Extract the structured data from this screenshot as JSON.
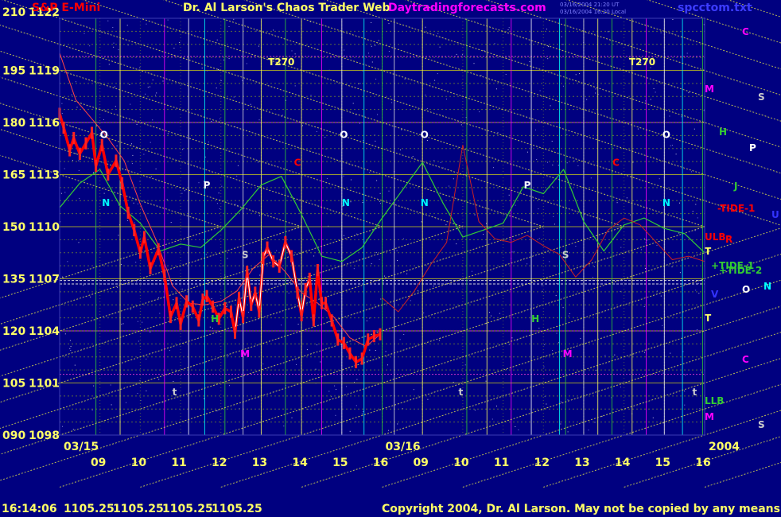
{
  "header": {
    "symbol": "S&P E-Mini",
    "title": "Dr. Al Larson's Chaos Trader Web",
    "site": "Daytradingforecasts.com",
    "stamp1": "03/16/2004 21:20 UT",
    "stamp2": "03/16/2004 16:20 Local",
    "file": "spcctom.txt"
  },
  "footer": {
    "time": "16:14:06",
    "quotes": [
      "1105.25",
      "1105.25",
      "1105.25",
      "1105.25"
    ],
    "copyright": "Copyright 2004, Dr. Al Larson. May not be copied by any means."
  },
  "colors": {
    "background": "#000080",
    "price_red": "#ff0000",
    "price_white": "#ffffff",
    "green_line": "#33cc33",
    "yellow_dot": "#ffff66",
    "magenta": "#ff00ff",
    "cyan": "#00ffff"
  },
  "chart_data": {
    "type": "line",
    "title": "S&P E-Mini",
    "left_axis_labels": [
      "210",
      "195",
      "180",
      "165",
      "150",
      "135",
      "120",
      "105",
      "090"
    ],
    "price_axis_labels": [
      "1122",
      "1119",
      "1116",
      "1113",
      "1110",
      "1107",
      "1104",
      "1101",
      "1098"
    ],
    "ylim": [
      1098,
      1122
    ],
    "date_labels": [
      "03/15",
      "03/16"
    ],
    "hour_labels": [
      "09",
      "10",
      "11",
      "12",
      "13",
      "14",
      "15",
      "16",
      "09",
      "10",
      "11",
      "12",
      "13",
      "14",
      "15",
      "16"
    ],
    "year_label": "2004",
    "xlim": [
      0,
      16
    ],
    "price_series": {
      "name": "price",
      "x": [
        0,
        0.1,
        0.25,
        0.35,
        0.5,
        0.65,
        0.8,
        0.9,
        1.05,
        1.2,
        1.4,
        1.55,
        1.7,
        1.85,
        2.0,
        2.1,
        2.25,
        2.45,
        2.6,
        2.75,
        2.9,
        3.0,
        3.15,
        3.3,
        3.45,
        3.55,
        3.65,
        3.8,
        3.95,
        4.1,
        4.25,
        4.35,
        4.45,
        4.55,
        4.65,
        4.75,
        4.85,
        4.95,
        5.05,
        5.15,
        5.3,
        5.45,
        5.6,
        5.75,
        5.9,
        6.0,
        6.1,
        6.2,
        6.3,
        6.4,
        6.5,
        6.6,
        6.75,
        6.9,
        7.05,
        7.2,
        7.35,
        7.5,
        7.65,
        7.8,
        7.95
      ],
      "values": [
        1116.5,
        1115.7,
        1114.4,
        1115.1,
        1114.2,
        1114.8,
        1115.4,
        1113.5,
        1114.7,
        1113.0,
        1113.8,
        1112.5,
        1110.8,
        1109.8,
        1108.5,
        1109.4,
        1107.6,
        1108.7,
        1107.2,
        1104.8,
        1105.6,
        1104.4,
        1105.7,
        1105.4,
        1104.6,
        1105.8,
        1106.0,
        1105.4,
        1104.7,
        1105.3,
        1105.1,
        1103.9,
        1105.9,
        1104.8,
        1107.4,
        1105.5,
        1106.2,
        1105.1,
        1108.2,
        1108.8,
        1108.0,
        1107.7,
        1109.1,
        1108.3,
        1106.2,
        1104.9,
        1106.4,
        1107.0,
        1104.6,
        1107.5,
        1105.6,
        1105.6,
        1104.6,
        1103.5,
        1103.3,
        1102.7,
        1102.2,
        1102.4,
        1103.5,
        1103.7,
        1103.8
      ]
    },
    "ma_series": {
      "name": "average",
      "x": [
        0,
        0.4,
        0.8,
        1.2,
        1.6,
        2.0,
        2.4,
        2.8,
        3.2,
        3.6,
        4.0,
        4.4,
        4.8,
        5.2,
        5.6,
        6.0,
        6.4,
        6.8,
        7.2,
        7.6,
        7.95
      ],
      "values": [
        1120.0,
        1117.3,
        1116.2,
        1115.1,
        1113.8,
        1111.3,
        1109.2,
        1106.6,
        1105.6,
        1105.5,
        1105.7,
        1106.3,
        1107.6,
        1108.4,
        1107.4,
        1106.2,
        1105.6,
        1104.8,
        1103.6,
        1103.1,
        1103.8
      ]
    },
    "green_series": {
      "name": "oscillator",
      "x": [
        0,
        0.5,
        1.0,
        1.5,
        2.0,
        2.5,
        3.0,
        3.5,
        4.0,
        4.5,
        5.0,
        5.5,
        6.0,
        6.5,
        7.0,
        7.5,
        8.0,
        8.5,
        9.0,
        9.5,
        10.0,
        10.5,
        11.0,
        11.5,
        12.0,
        12.5,
        13.0,
        13.5,
        14.0,
        14.5,
        15.0,
        15.5,
        16.0
      ],
      "values": [
        1111.1,
        1112.5,
        1113.3,
        1111.2,
        1110.2,
        1108.6,
        1109.0,
        1108.8,
        1109.8,
        1111.0,
        1112.4,
        1112.9,
        1110.7,
        1108.3,
        1108.0,
        1108.8,
        1110.5,
        1112.1,
        1113.7,
        1111.4,
        1109.4,
        1109.8,
        1110.2,
        1112.3,
        1111.9,
        1113.3,
        1110.3,
        1108.6,
        1110.1,
        1110.5,
        1109.9,
        1109.6,
        1108.5
      ]
    },
    "red_cycle_series": {
      "name": "cycle",
      "x": [
        8.0,
        8.4,
        8.8,
        9.2,
        9.6,
        10.0,
        10.4,
        10.8,
        11.2,
        11.6,
        12.0,
        12.4,
        12.8,
        13.2,
        13.6,
        14.0,
        14.4,
        14.8,
        15.2,
        15.6,
        16.0
      ],
      "values": [
        1105.9,
        1105.1,
        1106.3,
        1107.8,
        1109.1,
        1114.7,
        1110.3,
        1109.3,
        1109.1,
        1109.5,
        1108.9,
        1108.4,
        1107.1,
        1108.1,
        1109.8,
        1110.5,
        1110.1,
        1109.1,
        1108.1,
        1108.3,
        1108.0
      ]
    },
    "vertical_line_hours": [
      0.9,
      1.5,
      2.6,
      3.2,
      3.6,
      4.1,
      4.55,
      5.0,
      5.6,
      6.0,
      6.5,
      7.0,
      7.55,
      8.0,
      8.3,
      9.0,
      10.1,
      10.6,
      11.2,
      11.7,
      12.4,
      12.55,
      13.0,
      13.35,
      13.7,
      14.2,
      14.55,
      15.0,
      15.45,
      15.95
    ],
    "signal_labels": [
      {
        "text": "T270",
        "x": 5.5,
        "y": 1119.3,
        "color": "#ffff66"
      },
      {
        "text": "T270",
        "x": 14.45,
        "y": 1119.3,
        "color": "#ffff66"
      },
      {
        "text": "O",
        "x": 1.1,
        "y": 1115.1,
        "color": "#ffffff"
      },
      {
        "text": "O",
        "x": 7.05,
        "y": 1115.1,
        "color": "#ffffff"
      },
      {
        "text": "O",
        "x": 9.05,
        "y": 1115.1,
        "color": "#ffffff"
      },
      {
        "text": "O",
        "x": 15.05,
        "y": 1115.1,
        "color": "#ffffff"
      },
      {
        "text": "N",
        "x": 1.15,
        "y": 1111.2,
        "color": "#00ffff"
      },
      {
        "text": "N",
        "x": 7.1,
        "y": 1111.2,
        "color": "#00ffff"
      },
      {
        "text": "N",
        "x": 9.05,
        "y": 1111.2,
        "color": "#00ffff"
      },
      {
        "text": "N",
        "x": 15.05,
        "y": 1111.2,
        "color": "#00ffff"
      },
      {
        "text": "P",
        "x": 3.65,
        "y": 1112.2,
        "color": "#ffffff"
      },
      {
        "text": "P",
        "x": 11.6,
        "y": 1112.2,
        "color": "#ffffff"
      },
      {
        "text": "C",
        "x": 5.9,
        "y": 1113.5,
        "color": "#ff0000"
      },
      {
        "text": "C",
        "x": 13.8,
        "y": 1113.5,
        "color": "#ff0000"
      },
      {
        "text": "S",
        "x": 4.6,
        "y": 1108.2,
        "color": "#cccccc"
      },
      {
        "text": "S",
        "x": 12.55,
        "y": 1108.2,
        "color": "#cccccc"
      },
      {
        "text": "M",
        "x": 4.6,
        "y": 1102.5,
        "color": "#ff00ff"
      },
      {
        "text": "M",
        "x": 12.6,
        "y": 1102.5,
        "color": "#ff00ff"
      },
      {
        "text": "H",
        "x": 3.85,
        "y": 1104.5,
        "color": "#33cc33"
      },
      {
        "text": "H",
        "x": 11.8,
        "y": 1104.5,
        "color": "#33cc33"
      },
      {
        "text": "t",
        "x": 2.85,
        "y": 1100.3,
        "color": "#cccccc"
      },
      {
        "text": "t",
        "x": 9.95,
        "y": 1100.3,
        "color": "#cccccc"
      },
      {
        "text": "t",
        "x": 15.75,
        "y": 1100.3,
        "color": "#cccccc"
      }
    ],
    "right_labels": [
      {
        "text": "C",
        "color": "#ff00ff"
      },
      {
        "text": "M",
        "color": "#ff00ff"
      },
      {
        "text": "S",
        "color": "#cccccc"
      },
      {
        "text": "H",
        "color": "#33cc33"
      },
      {
        "text": "P",
        "color": "#ffffff"
      },
      {
        "text": "J",
        "color": "#33cc33"
      },
      {
        "text": "-TIDE-1",
        "color": "#ff0000"
      },
      {
        "text": "U",
        "color": "#3333ff"
      },
      {
        "text": "ULB",
        "color": "#ff0000"
      },
      {
        "text": "R",
        "color": "#ff0000"
      },
      {
        "text": "T",
        "color": "#ffff66"
      },
      {
        "text": "+TIDE-1",
        "color": "#33cc33"
      },
      {
        "text": "+TIDE-2",
        "color": "#33cc33"
      },
      {
        "text": "V",
        "color": "#3333ff"
      },
      {
        "text": "O",
        "color": "#ffffff"
      },
      {
        "text": "N",
        "color": "#00ffff"
      },
      {
        "text": "T",
        "color": "#ffff66"
      },
      {
        "text": "C",
        "color": "#ff00ff"
      },
      {
        "text": "LLB",
        "color": "#33cc33"
      },
      {
        "text": "M",
        "color": "#ff00ff"
      },
      {
        "text": "S",
        "color": "#cccccc"
      }
    ]
  }
}
